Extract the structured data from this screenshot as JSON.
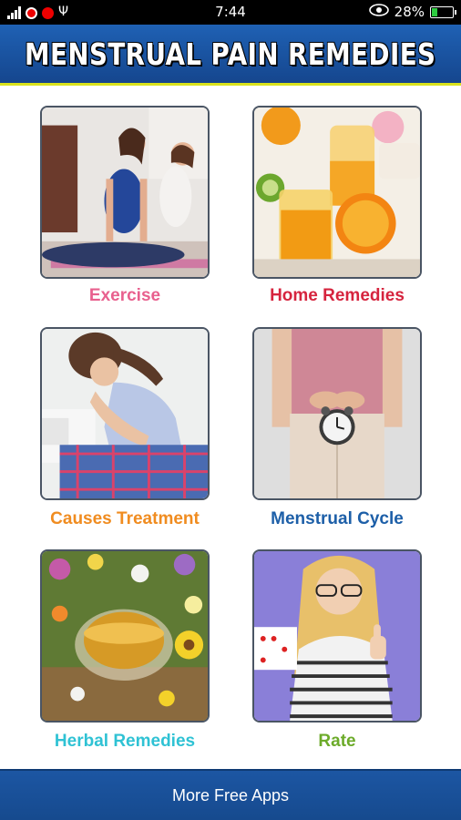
{
  "status_bar": {
    "time": "7:44",
    "battery_percent": "28%",
    "battery_level": 0.28,
    "left_icons": [
      "signal-icon",
      "vodafone-icon",
      "airtel-icon",
      "usb-icon"
    ],
    "right_icons": [
      "eye-icon",
      "battery-icon"
    ]
  },
  "header": {
    "title": "MENSTRUAL PAIN REMEDIES"
  },
  "tiles": [
    {
      "label": "Exercise",
      "label_color": "#e8608e",
      "image": "yoga-women-photo"
    },
    {
      "label": "Home Remedies",
      "label_color": "#d6243e",
      "image": "orange-juice-photo"
    },
    {
      "label": "Causes Treatment",
      "label_color": "#f08c20",
      "image": "woman-cramps-photo"
    },
    {
      "label": "Menstrual Cycle",
      "label_color": "#1d5fa8",
      "image": "alarm-clock-photo"
    },
    {
      "label": "Herbal Remedies",
      "label_color": "#2fc2d4",
      "image": "herbal-tea-photo"
    },
    {
      "label": "Rate",
      "label_color": "#6cab2a",
      "image": "thumbs-up-woman-photo"
    }
  ],
  "footer": {
    "label": "More Free Apps"
  },
  "colors": {
    "header_bg": "#1f61b4",
    "header_accent": "#d9e21c",
    "footer_bg": "#1c56a3"
  }
}
